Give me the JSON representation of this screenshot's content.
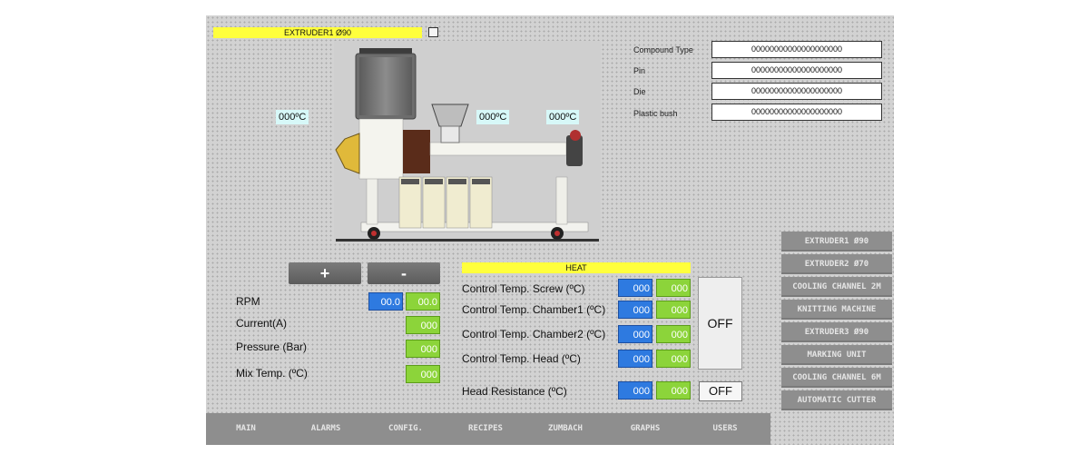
{
  "header": {
    "title": "EXTRUDER1 Ø90"
  },
  "machine": {
    "temps": [
      "000ºC",
      "000ºC",
      "000ºC"
    ]
  },
  "info": {
    "compound_type": {
      "label": "Compound Type",
      "value": "00000000000000000000"
    },
    "pin": {
      "label": "Pin",
      "value": "00000000000000000000"
    },
    "die": {
      "label": "Die",
      "value": "00000000000000000000"
    },
    "plastic_bush": {
      "label": "Plastic bush",
      "value": "00000000000000000000"
    }
  },
  "controls": {
    "plus_label": "+",
    "minus_label": "-"
  },
  "params": {
    "rpm": {
      "label": "RPM",
      "setpoint": "00.0",
      "actual": "00.0"
    },
    "current": {
      "label": "Current(A)",
      "value": "000"
    },
    "pressure": {
      "label": "Pressure (Bar)",
      "value": "000"
    },
    "mix_temp": {
      "label": "Mix Temp. (ºC)",
      "value": "000"
    }
  },
  "heat": {
    "title": "HEAT",
    "rows": [
      {
        "label": "Control Temp. Screw (ºC)",
        "setpoint": "000",
        "actual": "000"
      },
      {
        "label": "Control Temp. Chamber1 (ºC)",
        "setpoint": "000",
        "actual": "000"
      },
      {
        "label": "Control Temp. Chamber2 (ºC)",
        "setpoint": "000",
        "actual": "000"
      },
      {
        "label": "Control Temp. Head (ºC)",
        "setpoint": "000",
        "actual": "000"
      }
    ],
    "head_resistance": {
      "label": "Head Resistance (ºC)",
      "setpoint": "000",
      "actual": "000"
    },
    "off_main_label": "OFF",
    "off_head_label": "OFF"
  },
  "side_nav": [
    "EXTRUDER1 Ø90",
    "EXTRUDER2 Ø70",
    "COOLING CHANNEL 2M",
    "KNITTING MACHINE",
    "EXTRUDER3 Ø90",
    "MARKING UNIT",
    "COOLING CHANNEL 6M",
    "AUTOMATIC CUTTER"
  ],
  "bottom_nav": [
    "MAIN",
    "ALARMS",
    "CONFIG.",
    "RECIPES",
    "ZUMBACH",
    "GRAPHS",
    "USERS"
  ],
  "colors": {
    "title_yellow": "#ffff3c",
    "setpoint_blue": "#2e7ae0",
    "actual_green": "#8cd43a",
    "nav_gray": "#8e8e8e"
  }
}
